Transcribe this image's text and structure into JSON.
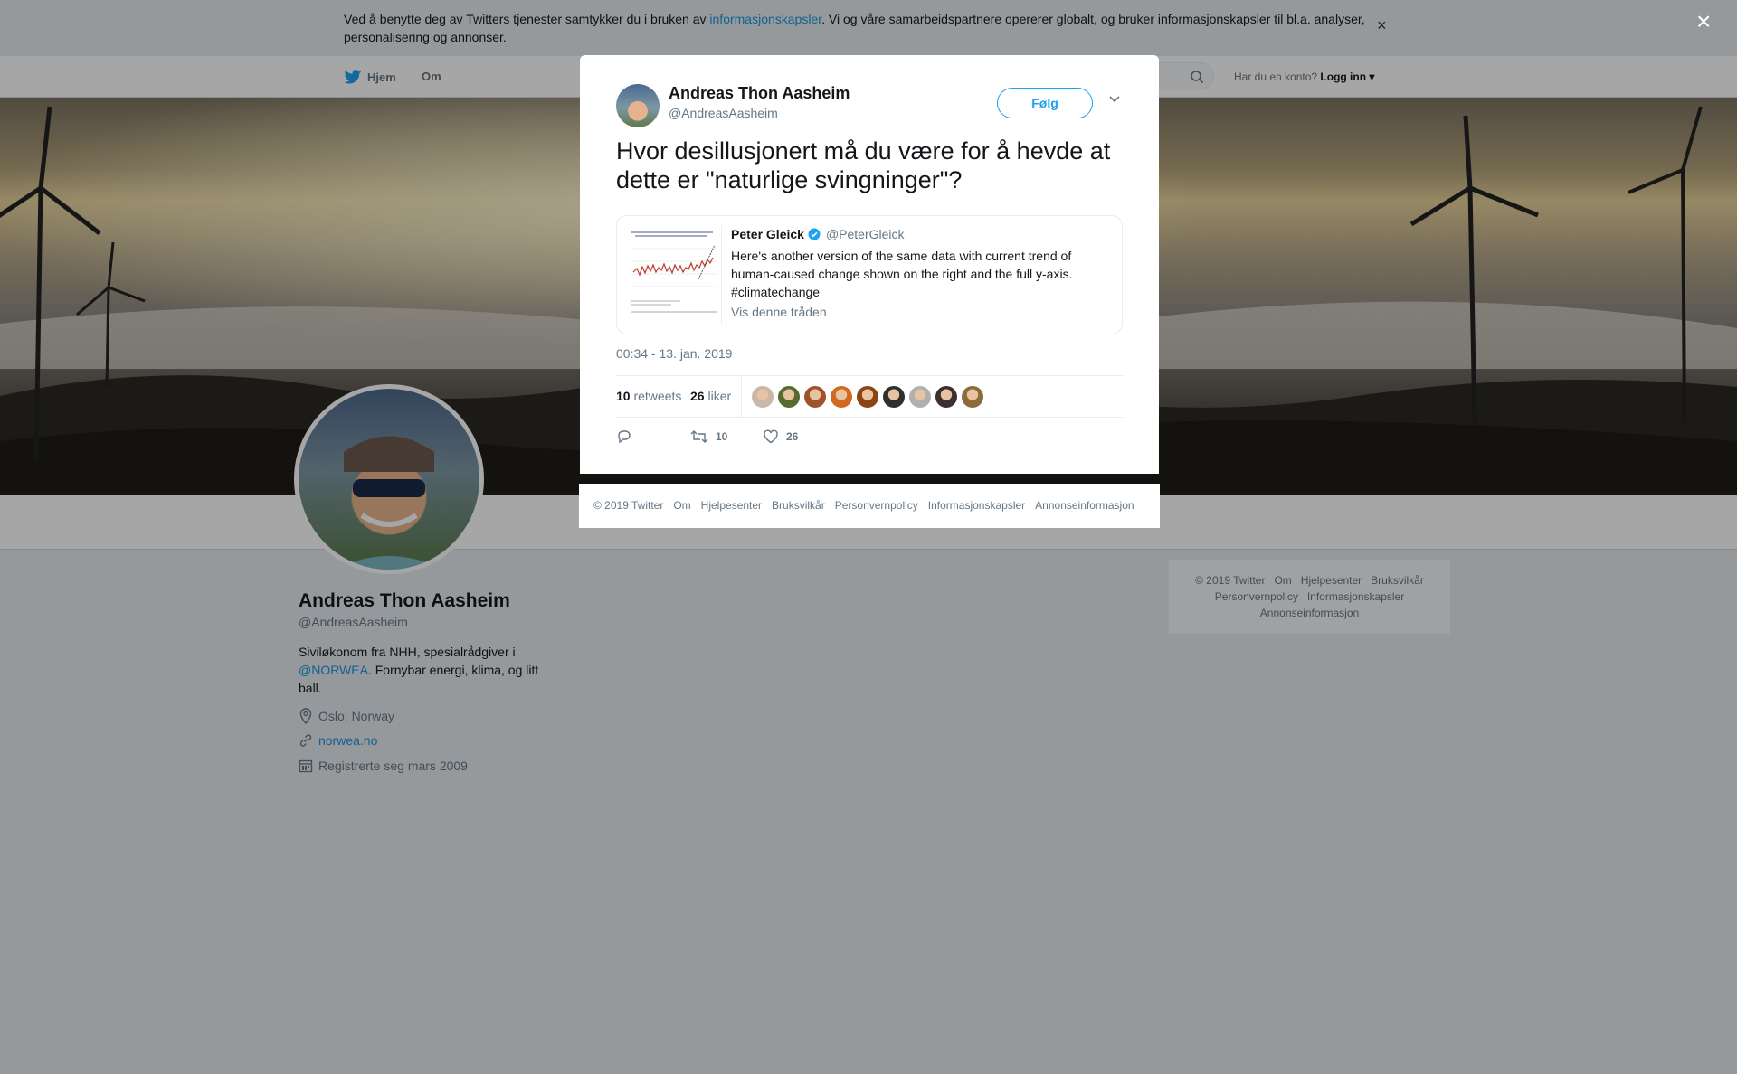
{
  "cookie_banner": {
    "text_before": "Ved å benytte deg av Twitters tjenester samtykker du i bruken av ",
    "link": "informasjonskapsler",
    "text_after": ". Vi og våre samarbeidspartnere opererer globalt, og bruker informasjonskapsler til bl.a. analyser, personalisering og annonser.",
    "close": "×"
  },
  "nav": {
    "home": "Hjem",
    "about": "Om",
    "account_prompt": "Har du en konto?",
    "login": "Logg inn"
  },
  "profile": {
    "name": "Andreas Thon Aasheim",
    "handle": "@AndreasAasheim",
    "bio_before": "Siviløkonom fra NHH, spesialrådgiver i ",
    "bio_link": "@NORWEA",
    "bio_after": ". Fornybar energi, klima, og litt ball.",
    "location": "Oslo, Norway",
    "website": "norwea.no",
    "joined": "Registrerte seg mars 2009"
  },
  "side_footer": [
    "© 2019 Twitter",
    "Om",
    "Hjelpesenter",
    "Bruksvilkår",
    "Personvernpolicy",
    "Informasjonskapsler",
    "Annonseinformasjon"
  ],
  "modal": {
    "close": "×",
    "author_name": "Andreas Thon Aasheim",
    "author_handle": "@AndreasAasheim",
    "follow": "Følg",
    "text": "Hvor desillusjonert må du være for å hevde at dette er \"naturlige svingninger\"?",
    "quote": {
      "name": "Peter Gleick",
      "handle": "@PeterGleick",
      "text": "Here's another version of the same data with current trend of human-caused change shown on the right and the full y-axis. #climatechange",
      "thread": "Vis denne tråden"
    },
    "timestamp": "00:34 - 13. jan. 2019",
    "retweets_count": "10",
    "retweets_label": "retweets",
    "likes_count": "26",
    "likes_label": "liker",
    "action_retweets": "10",
    "action_likes": "26",
    "liker_colors": [
      "#c9b8a8",
      "#556b2f",
      "#a0522d",
      "#d2691e",
      "#8b4513",
      "#2f2f2f",
      "#b0b0b0",
      "#3b2f2f",
      "#8b6b3a"
    ]
  },
  "modal_footer": [
    "© 2019 Twitter",
    "Om",
    "Hjelpesenter",
    "Bruksvilkår",
    "Personvernpolicy",
    "Informasjonskapsler",
    "Annonseinformasjon"
  ],
  "colors": {
    "twitter_blue": "#1da1f2",
    "link_blue": "#1b95e0",
    "muted": "#657786"
  }
}
